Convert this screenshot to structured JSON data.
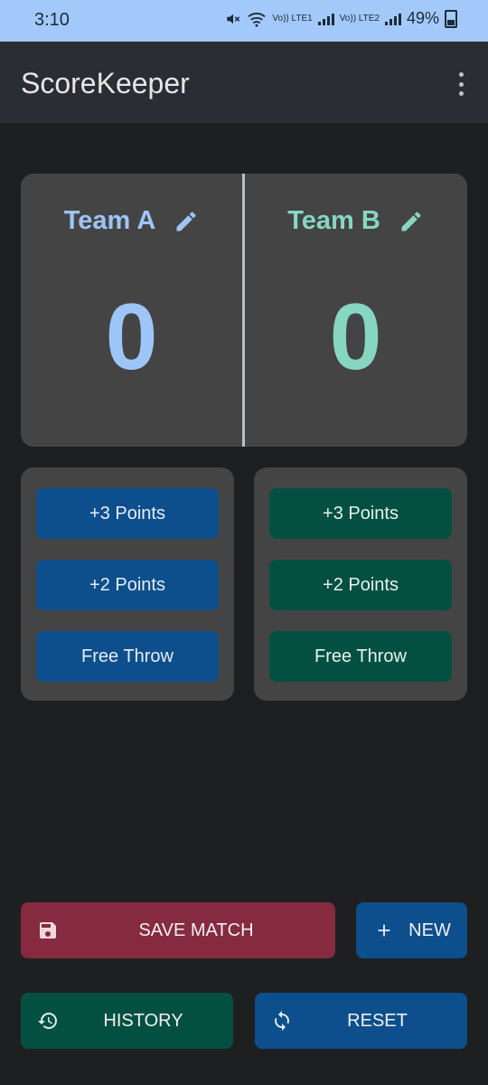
{
  "status_bar": {
    "time": "3:10",
    "sim1_label": "Vo)) LTE1",
    "sim2_label": "Vo)) LTE2",
    "battery": "49%"
  },
  "app_bar": {
    "title": "ScoreKeeper",
    "menu_icon": "more-vert-icon"
  },
  "scoreboard": {
    "team_a": {
      "name": "Team A",
      "score": "0",
      "color": "#9ec5f8"
    },
    "team_b": {
      "name": "Team B",
      "score": "0",
      "color": "#86d6c2"
    }
  },
  "team_a_controls": {
    "three_points": "+3 Points",
    "two_points": "+2 Points",
    "free_throw": "Free Throw"
  },
  "team_b_controls": {
    "three_points": "+3 Points",
    "two_points": "+2 Points",
    "free_throw": "Free Throw"
  },
  "actions": {
    "save_match": "SAVE MATCH",
    "new": "NEW",
    "history": "HISTORY",
    "reset": "RESET"
  },
  "colors": {
    "status_bar": "#a3c9fb",
    "blue_button": "#0d4f8c",
    "green_button": "#035042",
    "save_button": "#852a3f",
    "card": "#444444",
    "background": "#1e1f21"
  }
}
